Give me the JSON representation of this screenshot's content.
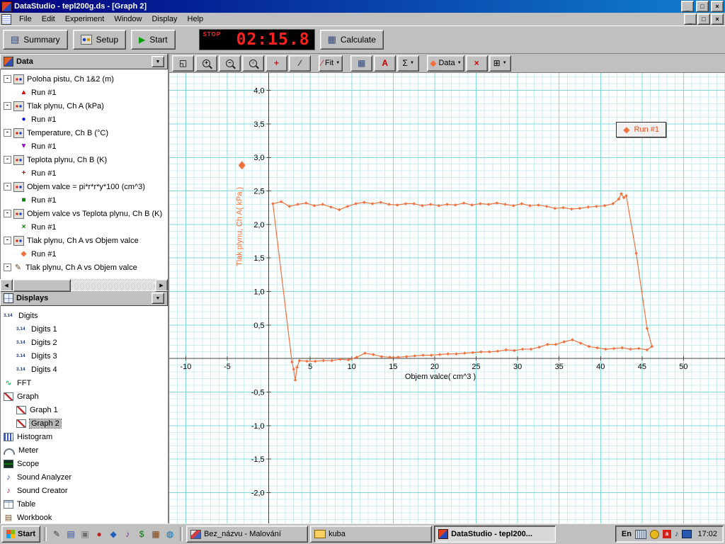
{
  "window": {
    "title": "DataStudio - tepl200g.ds - [Graph 2]"
  },
  "menu": {
    "items": [
      "File",
      "Edit",
      "Experiment",
      "Window",
      "Display",
      "Help"
    ]
  },
  "toolbar": {
    "summary_label": "Summary",
    "setup_label": "Setup",
    "start_label": "Start",
    "calculate_label": "Calculate",
    "timer": {
      "status": "STOP",
      "time": "02:15.8"
    }
  },
  "graph_toolbar": {
    "buttons": [
      {
        "name": "scale-to-fit-button",
        "icon": "scale-to-fit-icon",
        "glyph": "◱"
      },
      {
        "name": "zoom-in-button",
        "icon": "zoom-in-icon",
        "type": "mag",
        "glyph": "+"
      },
      {
        "name": "zoom-out-button",
        "icon": "zoom-out-icon",
        "type": "mag",
        "glyph": "−"
      },
      {
        "name": "zoom-select-button",
        "icon": "zoom-select-icon",
        "type": "mag",
        "glyph": "▫"
      },
      {
        "name": "smart-tool-button",
        "icon": "smart-tool-icon",
        "glyph": "+",
        "color": "#b02020",
        "bold": true
      },
      {
        "name": "slope-tool-button",
        "icon": "slope-tool-icon",
        "glyph": "∕",
        "color": "#303030",
        "bold": true
      },
      {
        "sep": true
      },
      {
        "name": "fit-dropdown",
        "icon": "fit-icon",
        "glyph": "∕",
        "color": "#b03030",
        "label": "Fit",
        "dropdown": true
      },
      {
        "sep": true
      },
      {
        "name": "calculator-button",
        "icon": "calculator-icon",
        "glyph": "▦",
        "color": "#304880"
      },
      {
        "name": "text-annotation-button",
        "icon": "text-icon",
        "glyph": "A",
        "color": "#c00000",
        "bold": true
      },
      {
        "name": "statistics-dropdown",
        "icon": "sigma-icon",
        "glyph": "Σ",
        "dropdown": true
      },
      {
        "sep": true
      },
      {
        "name": "data-dropdown",
        "icon": "run-marker-icon",
        "glyph": "◆",
        "color": "#f2703e",
        "label": "Data",
        "dropdown": true
      },
      {
        "name": "delete-button",
        "icon": "delete-x-icon",
        "glyph": "×",
        "color": "#cc0000",
        "bold": true
      },
      {
        "name": "graph-settings-dropdown",
        "icon": "grid-settings-icon",
        "glyph": "⊞",
        "dropdown": true
      }
    ]
  },
  "data_panel": {
    "header": "Data",
    "items": [
      {
        "label": "Poloha pistu, Ch 1&2 (m)",
        "type": "source",
        "icon": "measurement-icon"
      },
      {
        "label": "Run #1",
        "type": "run",
        "marker": "▲",
        "color": "#dd0000"
      },
      {
        "label": "Tlak plynu, Ch A (kPa)",
        "type": "source",
        "icon": "measurement-icon"
      },
      {
        "label": "Run #1",
        "type": "run",
        "marker": "●",
        "color": "#0000cc"
      },
      {
        "label": "Temperature, Ch B (°C)",
        "type": "source",
        "icon": "measurement-icon"
      },
      {
        "label": "Run #1",
        "type": "run",
        "marker": "▼",
        "color": "#9900cc"
      },
      {
        "label": "Teplota plynu, Ch B (K)",
        "type": "source",
        "icon": "measurement-icon"
      },
      {
        "label": "Run #1",
        "type": "run",
        "marker": "+",
        "color": "#cc0000"
      },
      {
        "label": "Objem valce = pi*r*r*y*100 (cm^3)",
        "type": "source",
        "icon": "calculation-icon"
      },
      {
        "label": "Run #1",
        "type": "run",
        "marker": "■",
        "color": "#008800"
      },
      {
        "label": "Objem valce vs Teplota plynu, Ch B (K)",
        "type": "source",
        "icon": "xy-data-icon"
      },
      {
        "label": "Run #1",
        "type": "run",
        "marker": "×",
        "color": "#007700"
      },
      {
        "label": "Tlak plynu, Ch A vs Objem valce",
        "type": "source",
        "icon": "xy-data-icon"
      },
      {
        "label": "Run #1",
        "type": "run",
        "marker": "◆",
        "color": "#f2703e"
      },
      {
        "label": "Tlak plynu, Ch A vs Objem valce",
        "type": "source",
        "icon": "pen-icon"
      }
    ]
  },
  "displays_panel": {
    "header": "Displays",
    "items": [
      {
        "label": "Digits",
        "icon": "digits-icon",
        "shape": "digits",
        "level": 1
      },
      {
        "label": "Digits 1",
        "icon": "digits-icon",
        "shape": "digits",
        "level": 2
      },
      {
        "label": "Digits 2",
        "icon": "digits-icon",
        "shape": "digits",
        "level": 2
      },
      {
        "label": "Digits 3",
        "icon": "digits-icon",
        "shape": "digits",
        "level": 2
      },
      {
        "label": "Digits 4",
        "icon": "digits-icon",
        "shape": "digits",
        "level": 2
      },
      {
        "label": "FFT",
        "icon": "fft-icon",
        "shape": "fft",
        "level": 1
      },
      {
        "label": "Graph",
        "icon": "graph-icon",
        "shape": "graph",
        "level": 1
      },
      {
        "label": "Graph 1",
        "icon": "graph-icon",
        "shape": "graph",
        "level": 2
      },
      {
        "label": "Graph 2",
        "icon": "graph-icon",
        "shape": "graph",
        "level": 2,
        "selected": true
      },
      {
        "label": "Histogram",
        "icon": "histogram-icon",
        "shape": "hist",
        "level": 1
      },
      {
        "label": "Meter",
        "icon": "meter-icon",
        "shape": "meter",
        "level": 1
      },
      {
        "label": "Scope",
        "icon": "scope-icon",
        "shape": "scope",
        "level": 1
      },
      {
        "label": "Sound Analyzer",
        "icon": "sound-analyzer-icon",
        "shape": "sound-a",
        "level": 1
      },
      {
        "label": "Sound Creator",
        "icon": "sound-creator-icon",
        "shape": "sound-c",
        "level": 1
      },
      {
        "label": "Table",
        "icon": "table-icon",
        "shape": "table",
        "level": 1
      },
      {
        "label": "Workbook",
        "icon": "workbook-icon",
        "shape": "book",
        "level": 1
      }
    ]
  },
  "chart_data": {
    "type": "scatter",
    "title": "",
    "xlabel": "Objem valce( cm^3 )",
    "ylabel": "Tlak plynu, Ch A( kPa )",
    "xlim": [
      -12,
      55
    ],
    "ylim": [
      -2.47,
      4.26
    ],
    "grid": {
      "minor_x": 1,
      "major_x": 5,
      "minor_y": 0.1,
      "major_y": 0.5,
      "minor_color": "#cdeef0",
      "major_color": "#7fd8dc",
      "axis_color": "#404040"
    },
    "x_ticks": [
      [
        -10,
        "-10"
      ],
      [
        -5,
        "-5"
      ],
      [
        5,
        "5"
      ],
      [
        10,
        "10"
      ],
      [
        15,
        "15"
      ],
      [
        20,
        "20"
      ],
      [
        25,
        "25"
      ],
      [
        30,
        "30"
      ],
      [
        35,
        "35"
      ],
      [
        40,
        "40"
      ],
      [
        45,
        "45"
      ],
      [
        50,
        "50"
      ]
    ],
    "y_ticks": [
      [
        4,
        "4,0"
      ],
      [
        3.5,
        "3,5"
      ],
      [
        3,
        "3,0"
      ],
      [
        2.5,
        "2,5"
      ],
      [
        2,
        "2,0"
      ],
      [
        1.5,
        "1,5"
      ],
      [
        1,
        "1,0"
      ],
      [
        0.5,
        "0,5"
      ],
      [
        -0.5,
        "-0,5"
      ],
      [
        -1,
        "-1,0"
      ],
      [
        -1.5,
        "-1,5"
      ],
      [
        -2,
        "-2,0"
      ]
    ],
    "legend": {
      "label": "Run #1",
      "position": "top-right"
    },
    "series": [
      {
        "name": "Run #1",
        "color": "#f2703e",
        "marker": "diamond",
        "points": [
          [
            0.5,
            2.31
          ],
          [
            1.5,
            2.34
          ],
          [
            2.5,
            2.27
          ],
          [
            3.5,
            2.3
          ],
          [
            4.5,
            2.32
          ],
          [
            5.5,
            2.28
          ],
          [
            6.5,
            2.3
          ],
          [
            7.5,
            2.26
          ],
          [
            8.5,
            2.22
          ],
          [
            9.5,
            2.27
          ],
          [
            10.5,
            2.31
          ],
          [
            11.5,
            2.33
          ],
          [
            12.5,
            2.31
          ],
          [
            13.5,
            2.33
          ],
          [
            14.5,
            2.3
          ],
          [
            15.5,
            2.29
          ],
          [
            16.5,
            2.31
          ],
          [
            17.5,
            2.31
          ],
          [
            18.5,
            2.28
          ],
          [
            19.5,
            2.3
          ],
          [
            20.5,
            2.28
          ],
          [
            21.5,
            2.3
          ],
          [
            22.5,
            2.29
          ],
          [
            23.5,
            2.32
          ],
          [
            24.5,
            2.29
          ],
          [
            25.5,
            2.31
          ],
          [
            26.5,
            2.3
          ],
          [
            27.5,
            2.32
          ],
          [
            28.5,
            2.3
          ],
          [
            29.5,
            2.28
          ],
          [
            30.5,
            2.31
          ],
          [
            31.5,
            2.28
          ],
          [
            32.5,
            2.29
          ],
          [
            33.5,
            2.27
          ],
          [
            34.5,
            2.24
          ],
          [
            35.5,
            2.25
          ],
          [
            36.5,
            2.23
          ],
          [
            37.5,
            2.24
          ],
          [
            38.5,
            2.26
          ],
          [
            39.5,
            2.27
          ],
          [
            40.5,
            2.28
          ],
          [
            41.5,
            2.31
          ],
          [
            42.2,
            2.38
          ],
          [
            42.5,
            2.46
          ],
          [
            42.8,
            2.4
          ],
          [
            43.1,
            2.43
          ],
          [
            44.3,
            1.57
          ],
          [
            45.6,
            0.45
          ],
          [
            46.2,
            0.18
          ],
          [
            45.6,
            0.13
          ],
          [
            44.6,
            0.15
          ],
          [
            43.6,
            0.14
          ],
          [
            42.6,
            0.16
          ],
          [
            41.6,
            0.15
          ],
          [
            40.6,
            0.14
          ],
          [
            39.6,
            0.16
          ],
          [
            38.6,
            0.18
          ],
          [
            37.6,
            0.23
          ],
          [
            36.6,
            0.28
          ],
          [
            35.6,
            0.25
          ],
          [
            34.6,
            0.21
          ],
          [
            33.6,
            0.21
          ],
          [
            32.6,
            0.17
          ],
          [
            31.6,
            0.14
          ],
          [
            30.6,
            0.14
          ],
          [
            29.6,
            0.12
          ],
          [
            28.6,
            0.13
          ],
          [
            27.6,
            0.11
          ],
          [
            26.6,
            0.1
          ],
          [
            25.6,
            0.1
          ],
          [
            24.6,
            0.09
          ],
          [
            23.6,
            0.08
          ],
          [
            22.6,
            0.07
          ],
          [
            21.6,
            0.07
          ],
          [
            20.6,
            0.06
          ],
          [
            19.6,
            0.05
          ],
          [
            18.6,
            0.05
          ],
          [
            17.6,
            0.04
          ],
          [
            16.6,
            0.03
          ],
          [
            15.6,
            0.02
          ],
          [
            14.6,
            0.02
          ],
          [
            13.6,
            0.03
          ],
          [
            12.6,
            0.06
          ],
          [
            11.6,
            0.08
          ],
          [
            10.6,
            0.02
          ],
          [
            9.6,
            -0.02
          ],
          [
            8.6,
            -0.01
          ],
          [
            7.6,
            -0.03
          ],
          [
            6.6,
            -0.03
          ],
          [
            5.6,
            -0.04
          ],
          [
            4.6,
            -0.04
          ],
          [
            3.7,
            -0.03
          ],
          [
            3.4,
            -0.13
          ],
          [
            3.2,
            -0.32
          ],
          [
            3.0,
            -0.16
          ],
          [
            2.8,
            -0.05
          ],
          [
            0.5,
            2.31
          ]
        ]
      }
    ]
  },
  "taskbar": {
    "start_label": "Start",
    "quick_launch": [
      {
        "name": "quick-launch-pen-icon",
        "glyph": "✎",
        "color": "#404040"
      },
      {
        "name": "quick-launch-document-icon",
        "glyph": "▤",
        "color": "#3050a0"
      },
      {
        "name": "quick-launch-window-icon",
        "glyph": "▣",
        "color": "#707070"
      },
      {
        "name": "quick-launch-record-icon",
        "glyph": "●",
        "color": "#c02020"
      },
      {
        "name": "quick-launch-diamond-icon",
        "glyph": "◆",
        "color": "#2060c0"
      },
      {
        "name": "quick-launch-media-icon",
        "glyph": "♪",
        "color": "#7030a0"
      },
      {
        "name": "quick-launch-money-icon",
        "glyph": "$",
        "color": "#107010"
      },
      {
        "name": "quick-launch-grid-icon",
        "glyph": "▦",
        "color": "#804010"
      },
      {
        "name": "quick-launch-globe-icon",
        "glyph": "◍",
        "color": "#0070c0"
      }
    ],
    "tasks": [
      {
        "label": "Bez_názvu - Malování",
        "icon": "paint-icon",
        "active": false
      },
      {
        "label": "kuba",
        "icon": "folder-icon",
        "active": false
      },
      {
        "label": "DataStudio - tepl200...",
        "icon": "datastudio-icon",
        "active": true
      }
    ],
    "tray": {
      "lang": "En",
      "time": "17:02"
    }
  }
}
